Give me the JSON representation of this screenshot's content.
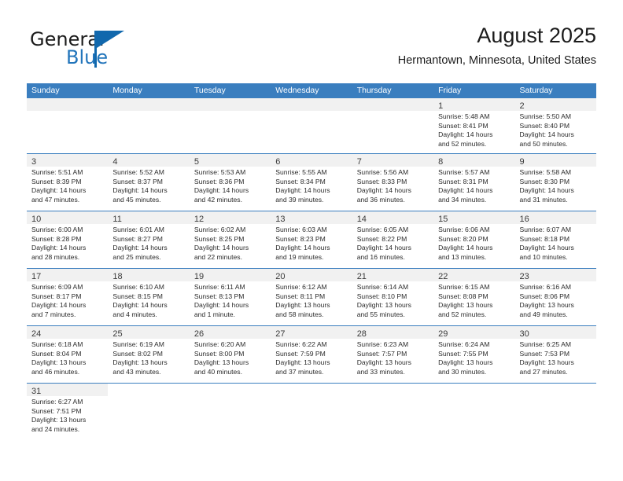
{
  "brand": {
    "name_top": "General",
    "name_bottom": "Blue",
    "flag_icon": "brand-flag-icon",
    "accent_color": "#1168ad"
  },
  "header": {
    "title": "August 2025",
    "subtitle": "Hermantown, Minnesota, United States"
  },
  "calendar": {
    "header_color": "#3a7ebf",
    "daynum_band_color": "#f1f1f1",
    "weekdays": [
      "Sunday",
      "Monday",
      "Tuesday",
      "Wednesday",
      "Thursday",
      "Friday",
      "Saturday"
    ],
    "weeks": [
      [
        {
          "day": "",
          "empty": true
        },
        {
          "day": "",
          "empty": true
        },
        {
          "day": "",
          "empty": true
        },
        {
          "day": "",
          "empty": true
        },
        {
          "day": "",
          "empty": true
        },
        {
          "day": "1",
          "sunrise": "Sunrise: 5:48 AM",
          "sunset": "Sunset: 8:41 PM",
          "daylight_line1": "Daylight: 14 hours",
          "daylight_line2": "and 52 minutes."
        },
        {
          "day": "2",
          "sunrise": "Sunrise: 5:50 AM",
          "sunset": "Sunset: 8:40 PM",
          "daylight_line1": "Daylight: 14 hours",
          "daylight_line2": "and 50 minutes."
        }
      ],
      [
        {
          "day": "3",
          "sunrise": "Sunrise: 5:51 AM",
          "sunset": "Sunset: 8:39 PM",
          "daylight_line1": "Daylight: 14 hours",
          "daylight_line2": "and 47 minutes."
        },
        {
          "day": "4",
          "sunrise": "Sunrise: 5:52 AM",
          "sunset": "Sunset: 8:37 PM",
          "daylight_line1": "Daylight: 14 hours",
          "daylight_line2": "and 45 minutes."
        },
        {
          "day": "5",
          "sunrise": "Sunrise: 5:53 AM",
          "sunset": "Sunset: 8:36 PM",
          "daylight_line1": "Daylight: 14 hours",
          "daylight_line2": "and 42 minutes."
        },
        {
          "day": "6",
          "sunrise": "Sunrise: 5:55 AM",
          "sunset": "Sunset: 8:34 PM",
          "daylight_line1": "Daylight: 14 hours",
          "daylight_line2": "and 39 minutes."
        },
        {
          "day": "7",
          "sunrise": "Sunrise: 5:56 AM",
          "sunset": "Sunset: 8:33 PM",
          "daylight_line1": "Daylight: 14 hours",
          "daylight_line2": "and 36 minutes."
        },
        {
          "day": "8",
          "sunrise": "Sunrise: 5:57 AM",
          "sunset": "Sunset: 8:31 PM",
          "daylight_line1": "Daylight: 14 hours",
          "daylight_line2": "and 34 minutes."
        },
        {
          "day": "9",
          "sunrise": "Sunrise: 5:58 AM",
          "sunset": "Sunset: 8:30 PM",
          "daylight_line1": "Daylight: 14 hours",
          "daylight_line2": "and 31 minutes."
        }
      ],
      [
        {
          "day": "10",
          "sunrise": "Sunrise: 6:00 AM",
          "sunset": "Sunset: 8:28 PM",
          "daylight_line1": "Daylight: 14 hours",
          "daylight_line2": "and 28 minutes."
        },
        {
          "day": "11",
          "sunrise": "Sunrise: 6:01 AM",
          "sunset": "Sunset: 8:27 PM",
          "daylight_line1": "Daylight: 14 hours",
          "daylight_line2": "and 25 minutes."
        },
        {
          "day": "12",
          "sunrise": "Sunrise: 6:02 AM",
          "sunset": "Sunset: 8:25 PM",
          "daylight_line1": "Daylight: 14 hours",
          "daylight_line2": "and 22 minutes."
        },
        {
          "day": "13",
          "sunrise": "Sunrise: 6:03 AM",
          "sunset": "Sunset: 8:23 PM",
          "daylight_line1": "Daylight: 14 hours",
          "daylight_line2": "and 19 minutes."
        },
        {
          "day": "14",
          "sunrise": "Sunrise: 6:05 AM",
          "sunset": "Sunset: 8:22 PM",
          "daylight_line1": "Daylight: 14 hours",
          "daylight_line2": "and 16 minutes."
        },
        {
          "day": "15",
          "sunrise": "Sunrise: 6:06 AM",
          "sunset": "Sunset: 8:20 PM",
          "daylight_line1": "Daylight: 14 hours",
          "daylight_line2": "and 13 minutes."
        },
        {
          "day": "16",
          "sunrise": "Sunrise: 6:07 AM",
          "sunset": "Sunset: 8:18 PM",
          "daylight_line1": "Daylight: 14 hours",
          "daylight_line2": "and 10 minutes."
        }
      ],
      [
        {
          "day": "17",
          "sunrise": "Sunrise: 6:09 AM",
          "sunset": "Sunset: 8:17 PM",
          "daylight_line1": "Daylight: 14 hours",
          "daylight_line2": "and 7 minutes."
        },
        {
          "day": "18",
          "sunrise": "Sunrise: 6:10 AM",
          "sunset": "Sunset: 8:15 PM",
          "daylight_line1": "Daylight: 14 hours",
          "daylight_line2": "and 4 minutes."
        },
        {
          "day": "19",
          "sunrise": "Sunrise: 6:11 AM",
          "sunset": "Sunset: 8:13 PM",
          "daylight_line1": "Daylight: 14 hours",
          "daylight_line2": "and 1 minute."
        },
        {
          "day": "20",
          "sunrise": "Sunrise: 6:12 AM",
          "sunset": "Sunset: 8:11 PM",
          "daylight_line1": "Daylight: 13 hours",
          "daylight_line2": "and 58 minutes."
        },
        {
          "day": "21",
          "sunrise": "Sunrise: 6:14 AM",
          "sunset": "Sunset: 8:10 PM",
          "daylight_line1": "Daylight: 13 hours",
          "daylight_line2": "and 55 minutes."
        },
        {
          "day": "22",
          "sunrise": "Sunrise: 6:15 AM",
          "sunset": "Sunset: 8:08 PM",
          "daylight_line1": "Daylight: 13 hours",
          "daylight_line2": "and 52 minutes."
        },
        {
          "day": "23",
          "sunrise": "Sunrise: 6:16 AM",
          "sunset": "Sunset: 8:06 PM",
          "daylight_line1": "Daylight: 13 hours",
          "daylight_line2": "and 49 minutes."
        }
      ],
      [
        {
          "day": "24",
          "sunrise": "Sunrise: 6:18 AM",
          "sunset": "Sunset: 8:04 PM",
          "daylight_line1": "Daylight: 13 hours",
          "daylight_line2": "and 46 minutes."
        },
        {
          "day": "25",
          "sunrise": "Sunrise: 6:19 AM",
          "sunset": "Sunset: 8:02 PM",
          "daylight_line1": "Daylight: 13 hours",
          "daylight_line2": "and 43 minutes."
        },
        {
          "day": "26",
          "sunrise": "Sunrise: 6:20 AM",
          "sunset": "Sunset: 8:00 PM",
          "daylight_line1": "Daylight: 13 hours",
          "daylight_line2": "and 40 minutes."
        },
        {
          "day": "27",
          "sunrise": "Sunrise: 6:22 AM",
          "sunset": "Sunset: 7:59 PM",
          "daylight_line1": "Daylight: 13 hours",
          "daylight_line2": "and 37 minutes."
        },
        {
          "day": "28",
          "sunrise": "Sunrise: 6:23 AM",
          "sunset": "Sunset: 7:57 PM",
          "daylight_line1": "Daylight: 13 hours",
          "daylight_line2": "and 33 minutes."
        },
        {
          "day": "29",
          "sunrise": "Sunrise: 6:24 AM",
          "sunset": "Sunset: 7:55 PM",
          "daylight_line1": "Daylight: 13 hours",
          "daylight_line2": "and 30 minutes."
        },
        {
          "day": "30",
          "sunrise": "Sunrise: 6:25 AM",
          "sunset": "Sunset: 7:53 PM",
          "daylight_line1": "Daylight: 13 hours",
          "daylight_line2": "and 27 minutes."
        }
      ],
      [
        {
          "day": "31",
          "sunrise": "Sunrise: 6:27 AM",
          "sunset": "Sunset: 7:51 PM",
          "daylight_line1": "Daylight: 13 hours",
          "daylight_line2": "and 24 minutes."
        },
        {
          "day": "",
          "empty": true,
          "blank": true
        },
        {
          "day": "",
          "empty": true,
          "blank": true
        },
        {
          "day": "",
          "empty": true,
          "blank": true
        },
        {
          "day": "",
          "empty": true,
          "blank": true
        },
        {
          "day": "",
          "empty": true,
          "blank": true
        },
        {
          "day": "",
          "empty": true,
          "blank": true
        }
      ]
    ]
  }
}
